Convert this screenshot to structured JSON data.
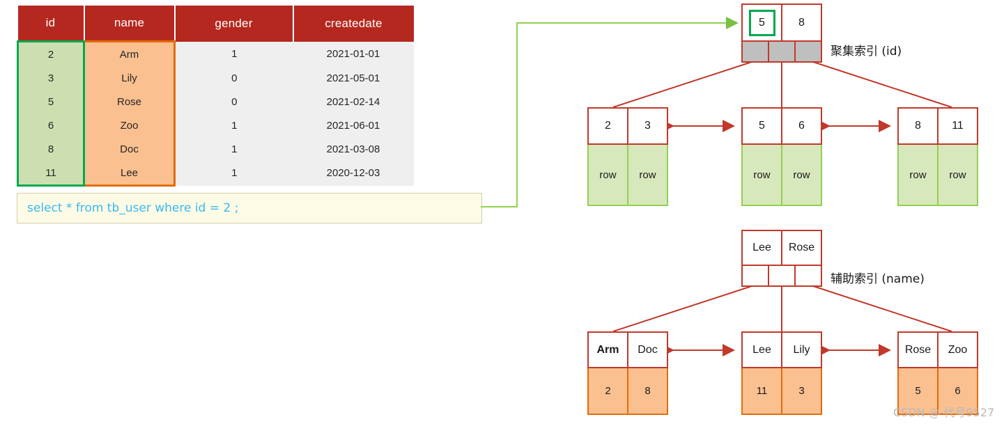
{
  "table": {
    "headers": [
      "id",
      "name",
      "gender",
      "createdate"
    ],
    "rows": [
      {
        "id": "2",
        "name": "Arm",
        "gender": "1",
        "createdate": "2021-01-01"
      },
      {
        "id": "3",
        "name": "Lily",
        "gender": "0",
        "createdate": "2021-05-01"
      },
      {
        "id": "5",
        "name": "Rose",
        "gender": "0",
        "createdate": "2021-02-14"
      },
      {
        "id": "6",
        "name": "Zoo",
        "gender": "1",
        "createdate": "2021-06-01"
      },
      {
        "id": "8",
        "name": "Doc",
        "gender": "1",
        "createdate": "2021-03-08"
      },
      {
        "id": "11",
        "name": "Lee",
        "gender": "1",
        "createdate": "2020-12-03"
      }
    ],
    "colors": {
      "header_bg": "#b5281f",
      "id_highlight_border": "#00a84f",
      "id_highlight_bg": "#cddfb0",
      "name_highlight_border": "#e36c09",
      "name_highlight_bg": "#fac090",
      "cell_bg": "#efefef"
    }
  },
  "sql": {
    "text": "select * from tb_user where id = 2 ;",
    "text_color": "#3cb8f0",
    "box_bg": "#fbfbe6"
  },
  "clustered_index": {
    "label": "聚集索引 (id)",
    "root": {
      "keys": [
        "5",
        "8"
      ],
      "highlighted_key": "5",
      "pointers": 3
    },
    "leaves": [
      {
        "keys": [
          "2",
          "3"
        ],
        "values": [
          "row",
          "row"
        ]
      },
      {
        "keys": [
          "5",
          "6"
        ],
        "values": [
          "row",
          "row"
        ]
      },
      {
        "keys": [
          "8",
          "11"
        ],
        "values": [
          "row",
          "row"
        ]
      }
    ]
  },
  "secondary_index": {
    "label": "辅助索引 (name)",
    "root": {
      "keys": [
        "Lee",
        "Rose"
      ],
      "pointers": 3
    },
    "leaves": [
      {
        "keys": [
          "Arm",
          "Doc"
        ],
        "bold_key": "Arm",
        "values": [
          "2",
          "8"
        ]
      },
      {
        "keys": [
          "Lee",
          "Lily"
        ],
        "bold_key": "",
        "values": [
          "11",
          "3"
        ]
      },
      {
        "keys": [
          "Rose",
          "Zoo"
        ],
        "bold_key": "",
        "values": [
          "5",
          "6"
        ]
      }
    ]
  },
  "watermark": {
    "text": "CSDN @-代号9527"
  },
  "accent_colors": {
    "node_border": "#c0392b",
    "arrow": "#c0392b",
    "query_arrow": "#92d050",
    "pointer_gray": "#bfbfbf"
  }
}
